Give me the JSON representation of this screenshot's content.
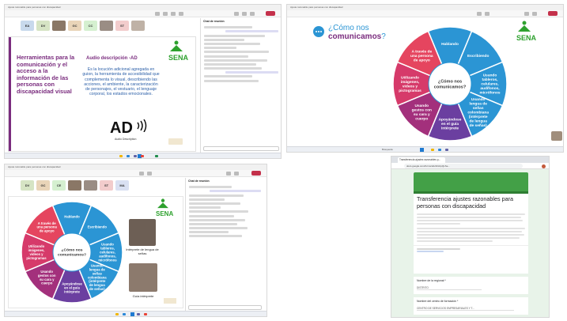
{
  "shot1": {
    "window_title": "Ajuste razonable para personas con discapacidad",
    "participants": [
      "EA",
      "DV",
      "GC",
      "CC",
      "ST"
    ],
    "heading": "Herramientas para la comunicación y el acceso a la información de las personas con discapacidad visual",
    "audio_title": "Audio descripción -AD",
    "audio_body": "Es la locución adicional agregada en guion, la herramienta de accesibilidad que complementa lo visual, describiendo las acciones, el ambiente, la caracterización de personajes, el vestuario, el lenguaje corporal, los estados emocionales.",
    "ad_logo": "AD",
    "ad_caption": "Audio Description",
    "sena": "SENA",
    "chat_title": "Chat de reunión"
  },
  "wheel": {
    "center": "¿Cómo nos comunicamos?",
    "segments": [
      {
        "label": "Hablando",
        "color": "#2b95d4"
      },
      {
        "label": "Escribiendo",
        "color": "#2b95d4"
      },
      {
        "label": "Usando tableros, celulares, audífonos, micrófonos",
        "color": "#2b95d4"
      },
      {
        "label": "Usando lengua de señas colombiana (intérprete de lengua de señas)",
        "color": "#2b95d4"
      },
      {
        "label": "Apoyándose en el guía intérprete",
        "color": "#6b3fa0"
      },
      {
        "label": "Usando gestos con su cara y cuerpo",
        "color": "#a3307c"
      },
      {
        "label": "Utilizando imágenes, videos y pictogramas",
        "color": "#d63a6a"
      },
      {
        "label": "A través de una persona de apoyo",
        "color": "#e5455f"
      }
    ]
  },
  "shot2": {
    "title_prefix": "¿Cómo nos",
    "title_bold": "comunicamos",
    "title_suffix": "?",
    "sena": "SENA",
    "search": "Búsqueda"
  },
  "shot3": {
    "participants": [
      "DV",
      "GC",
      "CE",
      "ST",
      "MA"
    ],
    "interpreter_caption": "Intérprete de lengua de señas",
    "guide_caption": "Guía intérprete",
    "sena": "SENA",
    "chat_title": "Chat de reunión"
  },
  "shot4": {
    "tab_title": "Transferencia ajustes razonables p...",
    "url": "docs.google.com/forms/d/e/1FAIpQLSe...",
    "form_title": "Transferencia ajustes razonables para personas con discapacidad",
    "field1_label": "Nombre de la regional *",
    "field1_value": "DISTRITO",
    "field2_label": "Nombre del centro de formación *",
    "field2_value": "CENTRO DE SERVICIOS EMPRESARIALES Y T..."
  },
  "colors": {
    "teams_purple": "#6264a7",
    "sena_green": "#2ea12e",
    "slide_purple": "#7a2c7e",
    "form_green": "#43a047"
  }
}
